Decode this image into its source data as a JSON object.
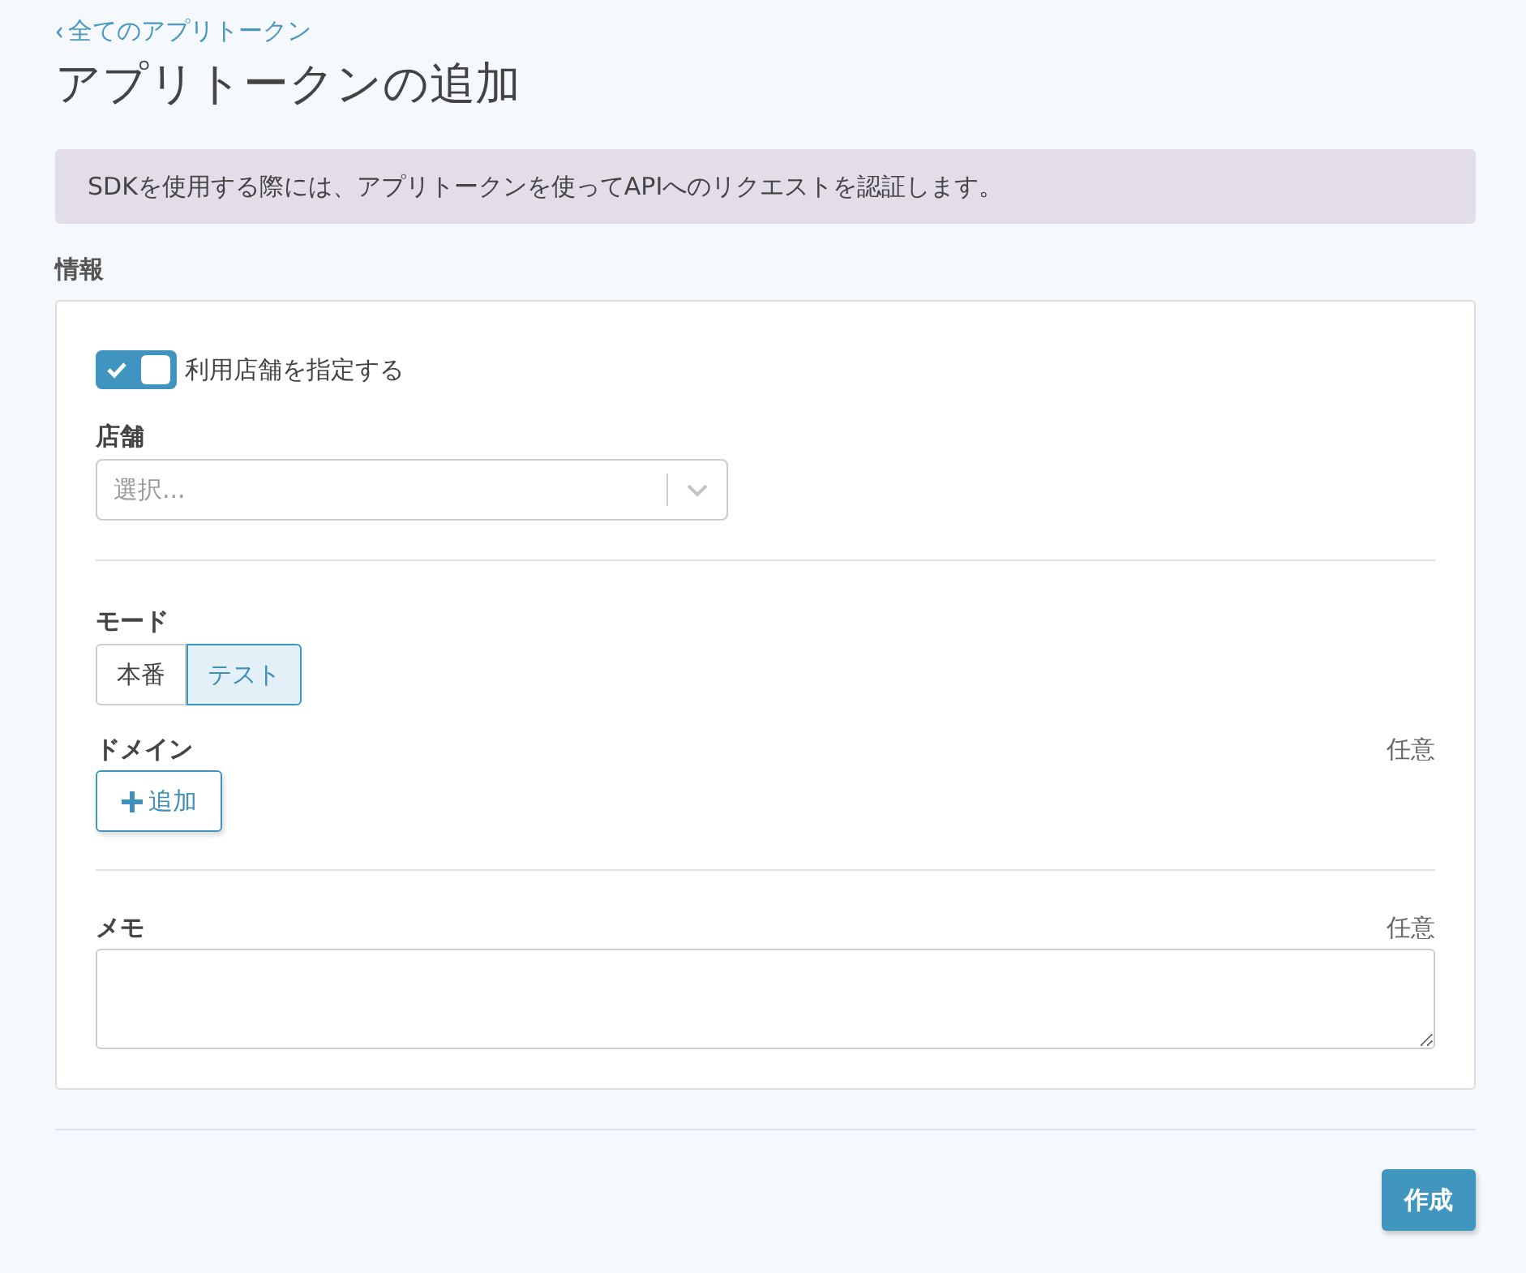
{
  "breadcrumb": "全てのアプリトークン",
  "title": "アプリトークンの追加",
  "notice": "SDKを使用する際には、アプリトークンを使ってAPIへのリクエストを認証します。",
  "section_title": "情報",
  "store_toggle": {
    "label": "利用店舗を指定する",
    "on": true
  },
  "store_field": {
    "label": "店舗",
    "placeholder": "選択..."
  },
  "mode": {
    "label": "モード",
    "options": [
      {
        "label": "本番",
        "selected": false
      },
      {
        "label": "テスト",
        "selected": true
      }
    ]
  },
  "domain": {
    "label": "ドメイン",
    "optional": "任意",
    "add_button": "追加"
  },
  "memo": {
    "label": "メモ",
    "optional": "任意"
  },
  "submit_button": "作成"
}
